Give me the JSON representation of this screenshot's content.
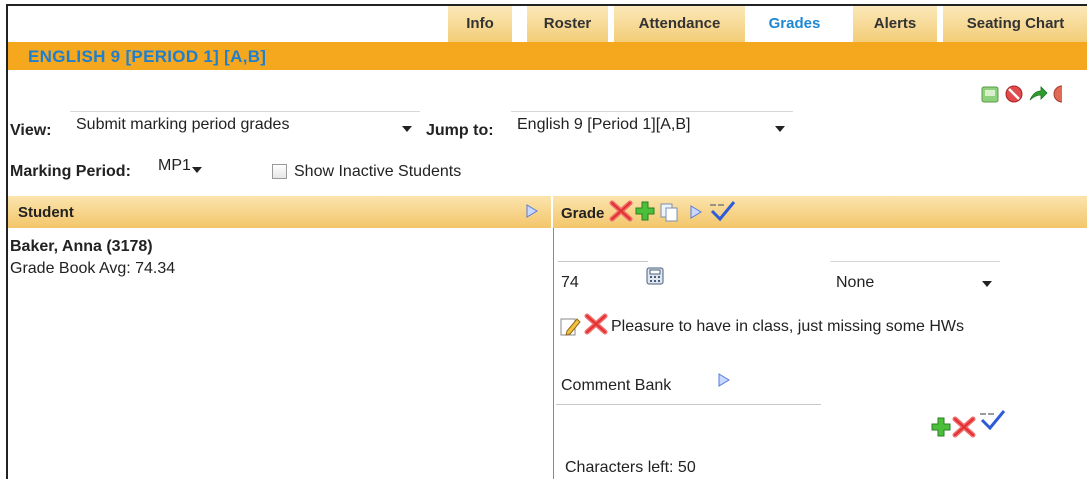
{
  "tabs": [
    {
      "label": "Info"
    },
    {
      "label": "Roster"
    },
    {
      "label": "Attendance"
    },
    {
      "label": "Grades",
      "active": true
    },
    {
      "label": "Alerts"
    },
    {
      "label": "Seating Chart"
    }
  ],
  "course": {
    "title": "ENGLISH 9 [PERIOD 1] [A,B]"
  },
  "controls": {
    "view_label": "View:",
    "view_value": "Submit marking period grades",
    "jump_label": "Jump to:",
    "jump_value": "English 9 [Period 1][A,B]",
    "marking_period_label": "Marking Period:",
    "marking_period_value": "MP1",
    "show_inactive_label": "Show Inactive Students",
    "show_inactive_checked": false
  },
  "columns": {
    "student": "Student",
    "grade": "Grade"
  },
  "student": {
    "name": "Baker, Anna (3178)",
    "avg": "Grade Book Avg: 74.34"
  },
  "grade": {
    "value": "74",
    "select_value": "None",
    "comment": "Pleasure to have in class, just missing some HWs",
    "comment_bank_label": "Comment Bank",
    "chars_left": "Characters left: 50"
  },
  "icons": {
    "top_actions": [
      "save-icon",
      "cancel-icon",
      "forward-icon",
      "help-icon"
    ],
    "grade_header": [
      "delete-icon",
      "add-icon",
      "copy-icon",
      "expand-icon",
      "spellcheck-icon"
    ],
    "comment_actions": [
      "edit-icon",
      "delete-icon"
    ],
    "bank_actions": [
      "add-icon",
      "delete-icon",
      "spellcheck-icon"
    ]
  },
  "colors": {
    "accent_orange": "#f5a81e",
    "title_blue": "#1e7fd0",
    "tab_gold": "#f3cd78"
  }
}
